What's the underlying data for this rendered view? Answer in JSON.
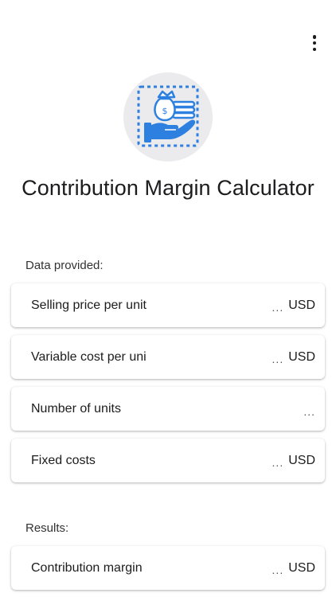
{
  "header": {
    "menu_icon": "more-vert-icon",
    "logo_icon": "hand-money-bag-icon",
    "title": "Contribution Margin Calculator"
  },
  "inputs": {
    "section_label": "Data provided:",
    "items": [
      {
        "label": "Selling price per unit",
        "value": "...",
        "unit": "USD"
      },
      {
        "label": "Variable cost per uni",
        "value": "...",
        "unit": "USD"
      },
      {
        "label": "Number of units",
        "value": "...",
        "unit": ""
      },
      {
        "label": "Fixed costs",
        "value": "...",
        "unit": "USD"
      }
    ]
  },
  "results": {
    "section_label": "Results:",
    "items": [
      {
        "label": "Contribution margin",
        "value": "...",
        "unit": "USD"
      }
    ]
  },
  "colors": {
    "accent": "#2d7fe0",
    "logo_bg": "#ebebed",
    "text": "#1c1c1e"
  }
}
